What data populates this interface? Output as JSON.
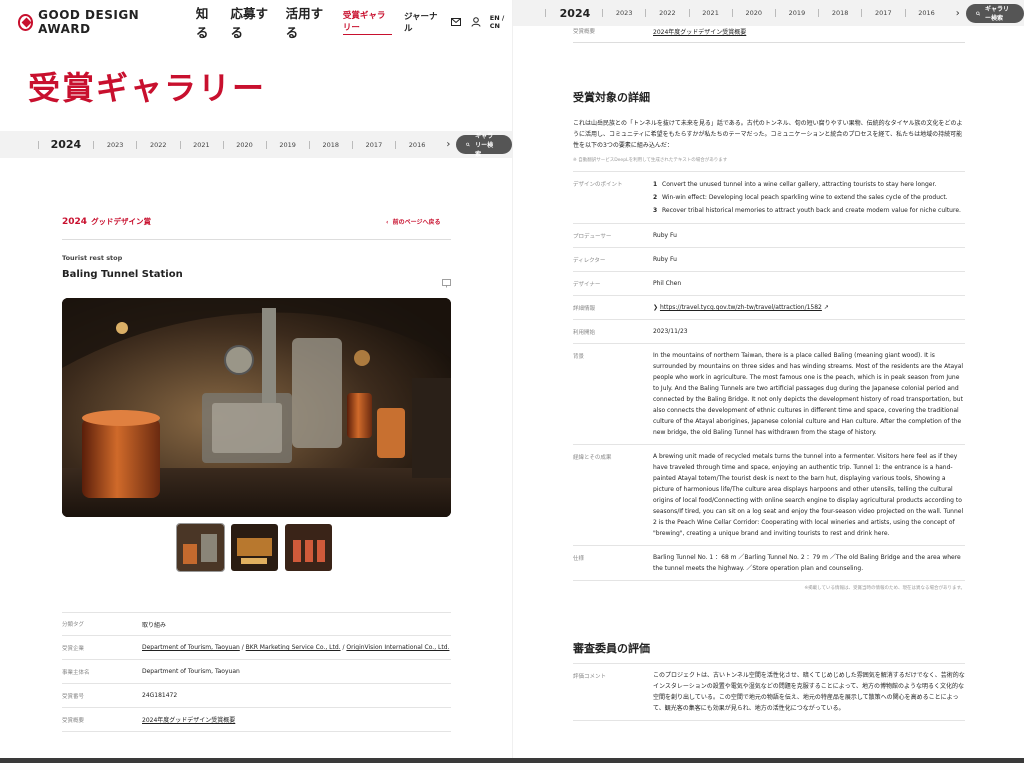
{
  "header": {
    "logo_text": "GOOD DESIGN AWARD",
    "nav_main": [
      "知る",
      "応募する",
      "活用する"
    ],
    "nav_sub": [
      "受賞ギャラリー",
      "ジャーナル"
    ],
    "lang": "EN / CN"
  },
  "page_title": "受賞ギャラリー",
  "yearbar": {
    "current": "2024",
    "years": [
      "2023",
      "2022",
      "2021",
      "2020",
      "2019",
      "2018",
      "2017",
      "2016"
    ],
    "gallery_search": "ギャラリー検索"
  },
  "award": {
    "year": "2024",
    "name": "グッドデザイン賞",
    "back_link": "前のページへ戻る"
  },
  "item": {
    "category": "Tourist rest stop",
    "title": "Baling Tunnel Station"
  },
  "info_table": [
    {
      "label": "分類タグ",
      "value": "取り組み"
    },
    {
      "label": "受賞企業",
      "value": [
        "Department of Tourism, Taoyuan",
        "BKR Marketing Service Co., Ltd.",
        "OriginVision International Co., Ltd."
      ]
    },
    {
      "label": "事業主体名",
      "value": "Department of Tourism, Taoyuan"
    },
    {
      "label": "受賞番号",
      "value": "24G181472"
    },
    {
      "label": "受賞概要",
      "value": "2024年度グッドデザイン受賞概要"
    }
  ],
  "right": {
    "top_row": {
      "label": "受賞概要",
      "value": "2024年度グッドデザイン受賞概要"
    },
    "details_title": "受賞対象の詳細",
    "description": "これは山岳民族との「トンネルを抜けて未来を見る」話である。古代のトンネル、旬の短い腐りやすい果物、伝統的なタイヤル族の文化をどのように活用し、コミュニティに希望をもたらすかが私たちのテーマだった。コミュニケーションと統合のプロセスを経て、私たちは地域の持続可能性を以下の3つの要素に組み込んだ：",
    "machine_note": "※ 自動翻訳サービスDeepLを利用して生成されたテキストの場合があります",
    "design_points_label": "デザインのポイント",
    "design_points": [
      {
        "n": "1",
        "text": "Convert the unused tunnel into a wine cellar gallery, attracting tourists to stay here longer."
      },
      {
        "n": "2",
        "text": "Win-win effect: Developing local peach sparkling wine to extend the sales cycle of the product."
      },
      {
        "n": "3",
        "text": "Recover tribal historical memories to attract youth back and create modern value for niche culture."
      }
    ],
    "rows": [
      {
        "label": "プロデューサー",
        "value": "Ruby Fu"
      },
      {
        "label": "ディレクター",
        "value": "Ruby Fu"
      },
      {
        "label": "デザイナー",
        "value": "Phil Chen"
      }
    ],
    "detail_label": "詳細情報",
    "detail_url": "https://travel.tycg.gov.tw/zh-tw/travel/attraction/1582",
    "start_label": "利用開始",
    "start_value": "2023/11/23",
    "background_label": "背景",
    "background": "In the mountains of northern Taiwan, there is a place called Baling (meaning giant wood). It is surrounded by mountains on three sides and has winding streams. Most of the residents are the Atayal people who work in agriculture. The most famous one is the peach, which is in peak season from June to July. And the Baling Tunnels are two artificial passages dug during the Japanese colonial period and connected by the Baling Bridge. It not only depicts the development history of road transportation, but also connects the development of ethnic cultures in different time and space, covering the traditional culture of the Atayal aborigines, Japanese colonial culture and Han culture. After the completion of the new bridge, the old Baling Tunnel has withdrawn from the stage of history.",
    "process_label": "経緯とその成果",
    "process": "A brewing unit made of recycled metals turns the tunnel into a fermenter. Visitors here feel as if they have traveled through time and space, enjoying an authentic trip. Tunnel 1: the entrance is a hand-painted Atayal totem/The tourist desk is next to the barn hut, displaying various tools, Showing a picture of harmonious life/The culture area displays harpoons and other utensils, telling the cultural origins of local food/Connecting with online search engine to display agricultural products according to seasons/If tired, you can sit on a log seat and enjoy the four-season video projected on the wall. Tunnel 2 is the Peach Wine Cellar Corridor: Cooperating with local wineries and artists, using the concept of \"brewing\", creating a unique brand and inviting tourists to rest and drink here.",
    "spec_label": "仕様",
    "spec": "Barling Tunnel No. 1 ：68 m ／Barling Tunnel No. 2 ：79 m ／The old Baling Bridge and the area where the tunnel meets the highway. ／Store operation plan and counseling.",
    "footnote": "※掲載している情報は、受賞当時の情報のため、現在は異なる場合があります。",
    "jury_title": "審査委員の評価",
    "jury_label": "評価コメント",
    "jury_comment": "このプロジェクトは、古いトンネル空間を活性化させ、暗くてじめじめした雰囲気を解消するだけでなく、芸術的なインスタレーションの設置や電気や湿気などの問題を克服することによって、地方の博物館のような明るく文化的な空間を創り出している。この空間で地元の物語を伝え、地元の特産品を展示して散策への関心を高めることによって、観光客の集客にも効果が見られ、地方の活性化につながっている。"
  },
  "colors": {
    "brand": "#c8102e",
    "button": "#555555"
  }
}
